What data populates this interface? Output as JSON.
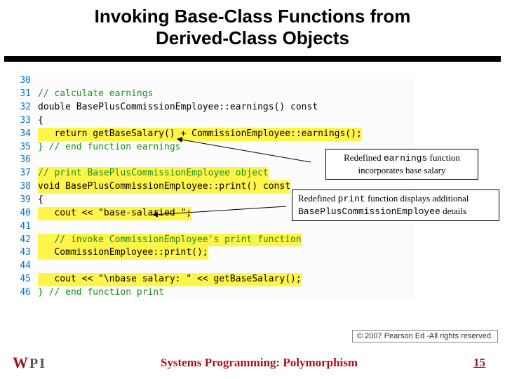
{
  "title": {
    "line1": "Invoking Base-Class Functions from",
    "line2": "Derived-Class Objects"
  },
  "code": [
    {
      "n": "30",
      "hl": false,
      "cls": "plain",
      "text": ""
    },
    {
      "n": "31",
      "hl": false,
      "cls": "cmt",
      "text": "// calculate earnings"
    },
    {
      "n": "32",
      "hl": false,
      "cls": "plain",
      "text": "double BasePlusCommissionEmployee::earnings() const"
    },
    {
      "n": "33",
      "hl": false,
      "cls": "plain",
      "text": "{"
    },
    {
      "n": "34",
      "hl": true,
      "cls": "plain",
      "text": "   return getBaseSalary() + CommissionEmployee::earnings();"
    },
    {
      "n": "35",
      "hl": false,
      "cls": "cmt",
      "text": "} // end function earnings"
    },
    {
      "n": "36",
      "hl": false,
      "cls": "plain",
      "text": ""
    },
    {
      "n": "37",
      "hl": true,
      "cls": "cmt",
      "text": "// print BasePlusCommissionEmployee object"
    },
    {
      "n": "38",
      "hl": true,
      "cls": "plain",
      "text": "void BasePlusCommissionEmployee::print() const"
    },
    {
      "n": "39",
      "hl": false,
      "cls": "plain",
      "text": "{"
    },
    {
      "n": "40",
      "hl": true,
      "cls": "plain",
      "text": "   cout << \"base-salaried \";"
    },
    {
      "n": "41",
      "hl": false,
      "cls": "plain",
      "text": ""
    },
    {
      "n": "42",
      "hl": true,
      "cls": "cmt",
      "text": "   // invoke CommissionEmployee's print function"
    },
    {
      "n": "43",
      "hl": true,
      "cls": "plain",
      "text": "   CommissionEmployee::print();"
    },
    {
      "n": "44",
      "hl": false,
      "cls": "plain",
      "text": ""
    },
    {
      "n": "45",
      "hl": true,
      "cls": "plain",
      "text": "   cout << \"\\nbase salary: \" << getBaseSalary();"
    },
    {
      "n": "46",
      "hl": false,
      "cls": "cmt",
      "text": "} // end function print"
    }
  ],
  "callouts": {
    "earnings": {
      "pre": "Redefined ",
      "code": "earnings",
      "post": " function incorporates base salary"
    },
    "print": {
      "pre": "Redefined ",
      "code1": "print",
      "mid": " function displays additional ",
      "code2": "BasePlusCommissionEmployee",
      "post": " details"
    }
  },
  "copyright": "© 2007 Pearson Ed -All rights reserved.",
  "footer": {
    "logo_w": "W",
    "logo_p": "P",
    "logo_i": "I",
    "title": "Systems Programming:  Polymorphism",
    "page": "15"
  }
}
